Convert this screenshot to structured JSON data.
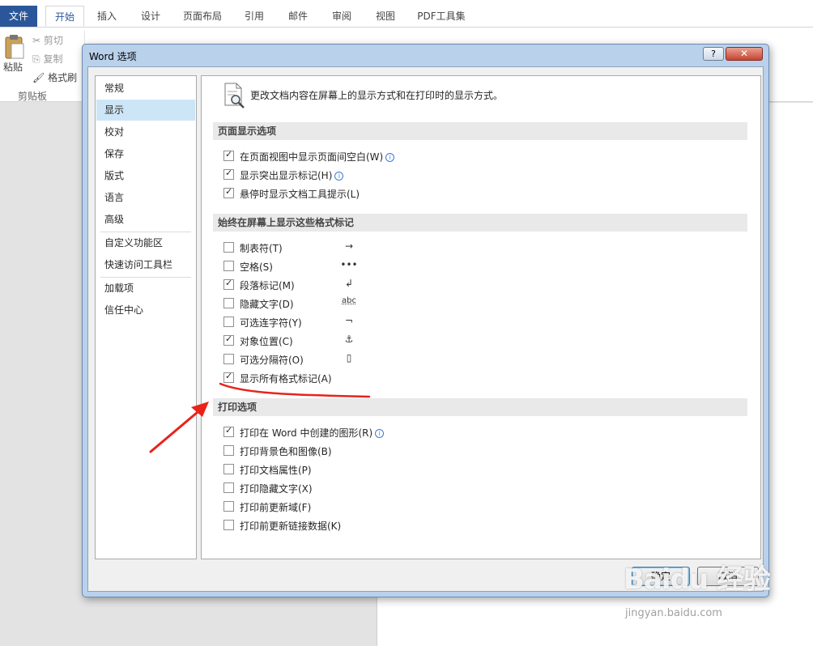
{
  "ribbon": {
    "tabs": [
      "文件",
      "开始",
      "插入",
      "设计",
      "页面布局",
      "引用",
      "邮件",
      "审阅",
      "视图",
      "PDF工具集"
    ],
    "clipboard": {
      "paste": "粘贴",
      "cut": "剪切",
      "copy": "复制",
      "format_painter": "格式刷",
      "group_label": "剪贴板"
    }
  },
  "dialog": {
    "title": "Word 选项",
    "help": "?",
    "close": "✕",
    "nav": [
      "常规",
      "显示",
      "校对",
      "保存",
      "版式",
      "语言",
      "高级",
      "自定义功能区",
      "快速访问工具栏",
      "加载项",
      "信任中心"
    ],
    "selected_nav": "显示",
    "intro": "更改文档内容在屏幕上的显示方式和在打印时的显示方式。",
    "sections": [
      {
        "title": "页面显示选项",
        "options": [
          {
            "label": "在页面视图中显示页面间空白(W)",
            "checked": true,
            "info": true
          },
          {
            "label": "显示突出显示标记(H)",
            "checked": true,
            "info": true
          },
          {
            "label": "悬停时显示文档工具提示(L)",
            "checked": true,
            "info": false
          }
        ]
      },
      {
        "title": "始终在屏幕上显示这些格式标记",
        "options": [
          {
            "label": "制表符(T)",
            "checked": false,
            "symbol": "→"
          },
          {
            "label": "空格(S)",
            "checked": false,
            "symbol": "•••"
          },
          {
            "label": "段落标记(M)",
            "checked": true,
            "symbol": "↲"
          },
          {
            "label": "隐藏文字(D)",
            "checked": false,
            "symbol": "abc"
          },
          {
            "label": "可选连字符(Y)",
            "checked": false,
            "symbol": "¬"
          },
          {
            "label": "对象位置(C)",
            "checked": true,
            "symbol": "⚓"
          },
          {
            "label": "可选分隔符(O)",
            "checked": false,
            "symbol": "▯"
          },
          {
            "label": "显示所有格式标记(A)",
            "checked": true,
            "symbol": ""
          }
        ]
      },
      {
        "title": "打印选项",
        "options": [
          {
            "label": "打印在 Word 中创建的图形(R)",
            "checked": true,
            "info": true
          },
          {
            "label": "打印背景色和图像(B)",
            "checked": false,
            "info": false
          },
          {
            "label": "打印文档属性(P)",
            "checked": false,
            "info": false
          },
          {
            "label": "打印隐藏文字(X)",
            "checked": false,
            "info": false
          },
          {
            "label": "打印前更新域(F)",
            "checked": false,
            "info": false
          },
          {
            "label": "打印前更新链接数据(K)",
            "checked": false,
            "info": false
          }
        ]
      }
    ],
    "ok": "确定",
    "cancel": "取消"
  },
  "annotation_color": "#e8231b",
  "watermark": {
    "logo": "Baidu 经验",
    "url": "jingyan.baidu.com"
  }
}
